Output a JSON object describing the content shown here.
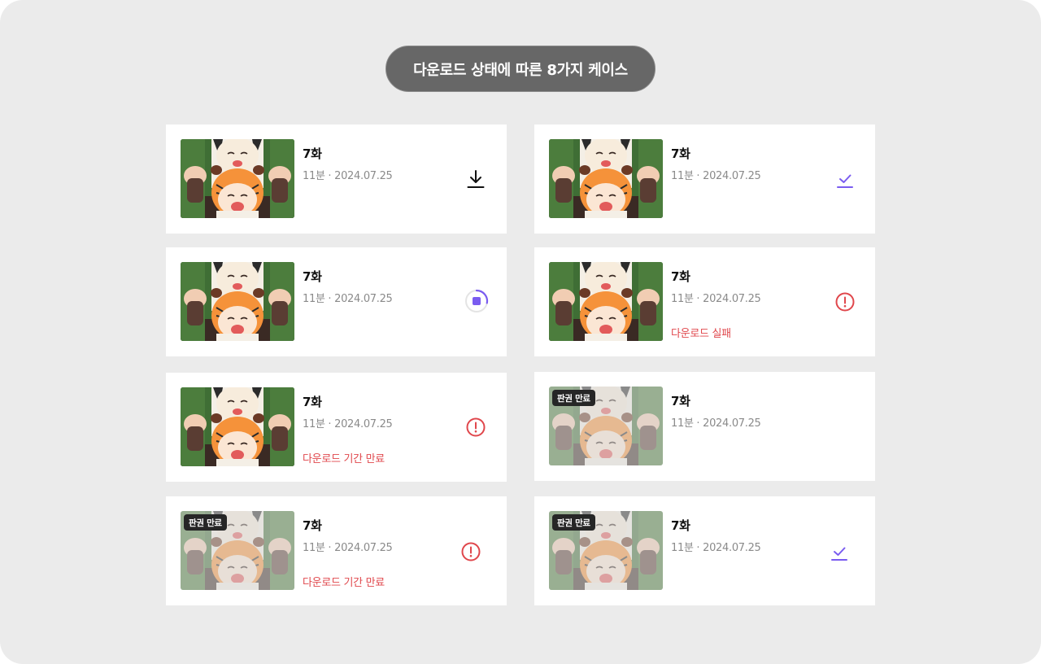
{
  "page": {
    "title": "다운로드 상태에 따른 8가지 케이스"
  },
  "colors": {
    "background": "#ebebeb",
    "card": "#ffffff",
    "accent_purple": "#7a5cf0",
    "error_red": "#e0474c",
    "meta_gray": "#8a8a8a"
  },
  "cards": [
    {
      "title": "7화",
      "meta": "11분 · 2024.07.25",
      "status": "",
      "badge": "",
      "icon": "download-icon"
    },
    {
      "title": "7화",
      "meta": "11분 · 2024.07.25",
      "status": "",
      "badge": "",
      "icon": "downloaded-check-icon"
    },
    {
      "title": "7화",
      "meta": "11분 · 2024.07.25",
      "status": "",
      "badge": "",
      "icon": "downloading-progress-icon",
      "progress": 0.28
    },
    {
      "title": "7화",
      "meta": "11분 · 2024.07.25",
      "status": "다운로드 실패",
      "badge": "",
      "icon": "error-icon"
    },
    {
      "title": "7화",
      "meta": "11분 · 2024.07.25",
      "status": "다운로드 기간 만료",
      "badge": "",
      "icon": "error-icon"
    },
    {
      "title": "7화",
      "meta": "11분 · 2024.07.25",
      "status": "",
      "badge": "판권 만료",
      "icon": ""
    },
    {
      "title": "7화",
      "meta": "11분 · 2024.07.25",
      "status": "다운로드 기간 만료",
      "badge": "판권 만료",
      "icon": "error-icon"
    },
    {
      "title": "7화",
      "meta": "11분 · 2024.07.25",
      "status": "",
      "badge": "판권 만료",
      "icon": "downloaded-check-icon"
    }
  ]
}
